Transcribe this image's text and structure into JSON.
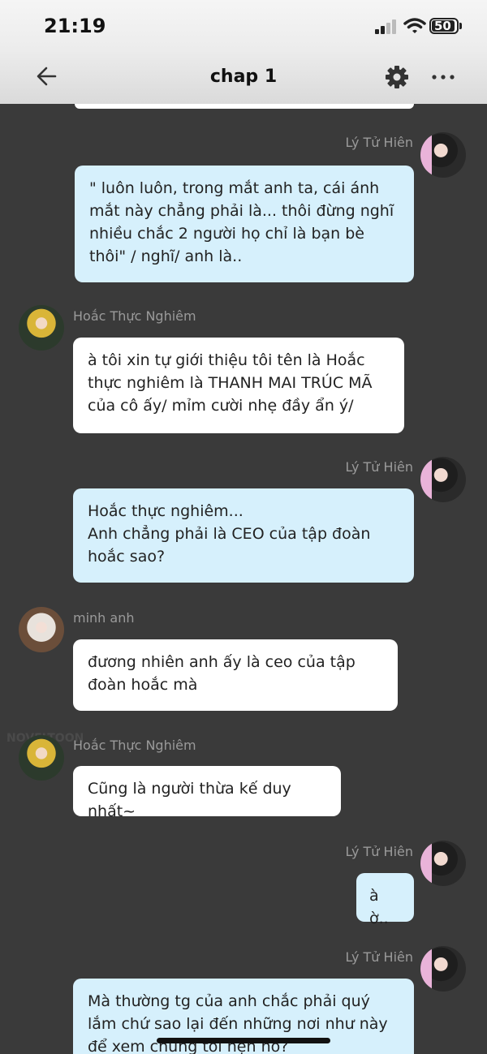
{
  "status": {
    "time": "21:19",
    "battery": "50"
  },
  "nav": {
    "title": "chap 1"
  },
  "watermark": "NOVELTOON",
  "messages": [
    {
      "sender": "Lý Tử Hiên",
      "text": "\" luôn luôn, trong mắt anh ta,  cái ánh mắt này chẳng phải là... thôi đừng nghĩ nhiều chắc 2 người họ chỉ là bạn bè thôi\" / nghĩ/ anh là.."
    },
    {
      "sender": "Hoắc Thực Nghiêm",
      "text": "à tôi xin tự giới thiệu tôi tên là Hoắc thực nghiêm là THANH MAI TRÚC MÃ của cô ấy/ mỉm cười nhẹ đầy ẩn ý/"
    },
    {
      "sender": "Lý Tử Hiên",
      "text": "Hoắc thực nghiêm...\nAnh chẳng phải là CEO của tập đoàn hoắc sao?"
    },
    {
      "sender": "minh anh",
      "text": "đương nhiên anh ấy là ceo của tập đoàn hoắc mà"
    },
    {
      "sender": "Hoắc Thực Nghiêm",
      "text": "Cũng là người thừa kế duy nhất~"
    },
    {
      "sender": "Lý Tử Hiên",
      "text": "à ờ.."
    },
    {
      "sender": "Lý Tử Hiên",
      "text": "Mà thường tg của anh chắc phải quý lắm chứ sao lại đến những nơi như này để xem chúng tôi hẹn hò?"
    }
  ],
  "colors": {
    "background": "#3a3a3a",
    "bubble_self": "#d6f0fc",
    "bubble_other": "#ffffff",
    "name": "#9a9a9a"
  },
  "icons": {
    "back": "arrow-left-icon",
    "settings": "gear-icon",
    "more": "more-dots-icon"
  }
}
